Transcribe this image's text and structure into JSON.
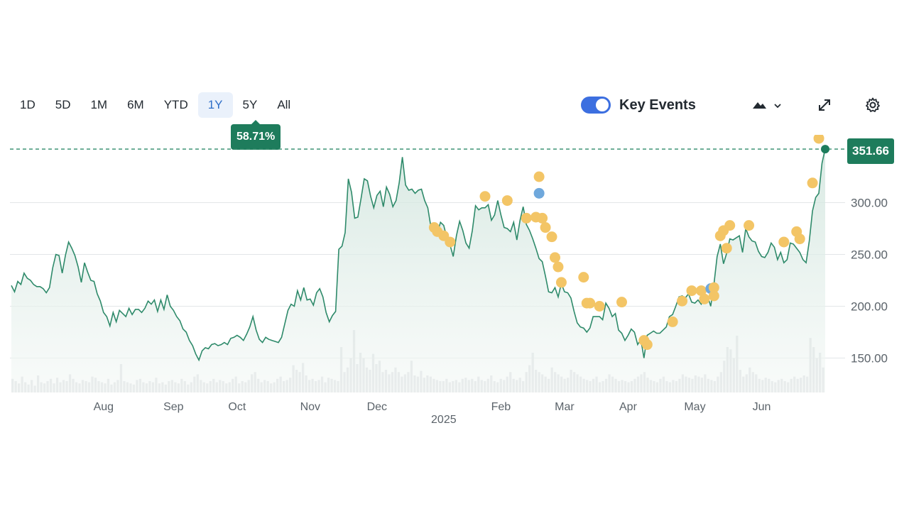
{
  "range_tabs": [
    "1D",
    "5D",
    "1M",
    "6M",
    "YTD",
    "1Y",
    "5Y",
    "All"
  ],
  "active_range": "1Y",
  "performance_badge": "58.71%",
  "key_events": {
    "label": "Key Events",
    "enabled": true
  },
  "toolbar_icons": [
    "mountain-chart-icon",
    "chevron-down-icon",
    "expand-icon",
    "gear-icon"
  ],
  "current_price_label": "351.66",
  "colors": {
    "line": "#2e8a6a",
    "area": "#e2efea",
    "accent": "#1e7c5c",
    "event": "#f3c566",
    "event_alt": "#6fa8dc",
    "toggle": "#3c6fe0"
  },
  "chart_data": {
    "type": "line",
    "y_ticks": [
      "150.00",
      "200.00",
      "250.00",
      "300.00"
    ],
    "y_tick_values": [
      150,
      200,
      250,
      300
    ],
    "ylim": [
      125,
      375
    ],
    "x_tick_labels": [
      "Aug",
      "Sep",
      "Oct",
      "Nov",
      "Dec",
      "2025",
      "Feb",
      "Mar",
      "Apr",
      "May",
      "Jun"
    ],
    "x_tick_positions": [
      29,
      51,
      71,
      94,
      115,
      136,
      154,
      174,
      194,
      215,
      236
    ],
    "last_value": 351.66,
    "reference_line": 351.66,
    "series": [
      {
        "values": [
          220,
          214,
          224,
          221,
          232,
          227,
          225,
          221,
          219,
          219,
          217,
          213,
          218,
          237,
          250,
          249,
          232,
          249,
          262,
          256,
          249,
          238,
          223,
          242,
          233,
          225,
          224,
          212,
          205,
          194,
          190,
          181,
          194,
          185,
          196,
          193,
          190,
          198,
          192,
          197,
          197,
          194,
          198,
          205,
          202,
          206,
          195,
          206,
          197,
          211,
          200,
          196,
          190,
          186,
          178,
          175,
          167,
          162,
          154,
          148,
          157,
          160,
          159,
          163,
          164,
          162,
          163,
          165,
          163,
          169,
          170,
          172,
          170,
          167,
          173,
          180,
          190,
          177,
          168,
          165,
          170,
          168,
          167,
          166,
          165,
          170,
          183,
          196,
          202,
          200,
          215,
          206,
          218,
          206,
          207,
          201,
          213,
          217,
          209,
          194,
          185,
          191,
          195,
          255,
          258,
          271,
          323,
          310,
          285,
          286,
          304,
          323,
          321,
          306,
          295,
          307,
          311,
          296,
          315,
          308,
          296,
          302,
          319,
          344,
          317,
          312,
          313,
          309,
          312,
          313,
          302,
          295,
          276,
          278,
          271,
          281,
          278,
          266,
          259,
          248,
          268,
          282,
          273,
          261,
          256,
          273,
          297,
          293,
          295,
          295,
          298,
          283,
          288,
          302,
          288,
          276,
          275,
          272,
          281,
          264,
          283,
          296,
          279,
          273,
          265,
          256,
          246,
          243,
          229,
          214,
          213,
          218,
          209,
          222,
          214,
          213,
          208,
          195,
          184,
          180,
          179,
          175,
          179,
          190,
          190,
          190,
          187,
          203,
          198,
          190,
          193,
          177,
          174,
          167,
          172,
          178,
          175,
          163,
          168,
          150,
          172,
          174,
          176,
          174,
          174,
          177,
          180,
          190,
          192,
          200,
          209,
          210,
          208,
          212,
          204,
          203,
          206,
          202,
          209,
          210,
          200,
          221,
          248,
          260,
          241,
          251,
          265,
          264,
          266,
          268,
          252,
          275,
          267,
          263,
          262,
          253,
          248,
          247,
          252,
          261,
          257,
          245,
          252,
          242,
          245,
          261,
          260,
          256,
          252,
          245,
          242,
          263,
          292,
          305,
          309,
          338,
          352
        ],
        "area": true
      }
    ],
    "events": [
      {
        "i": 133,
        "v": 276,
        "kind": "earnings"
      },
      {
        "i": 134,
        "v": 272,
        "kind": "earnings"
      },
      {
        "i": 136,
        "v": 268,
        "kind": "earnings"
      },
      {
        "i": 138,
        "v": 262,
        "kind": "earnings"
      },
      {
        "i": 149,
        "v": 306,
        "kind": "earnings"
      },
      {
        "i": 156,
        "v": 302,
        "kind": "earnings"
      },
      {
        "i": 162,
        "v": 285,
        "kind": "earnings"
      },
      {
        "i": 165,
        "v": 286,
        "kind": "earnings"
      },
      {
        "i": 166,
        "v": 325,
        "kind": "earnings"
      },
      {
        "i": 166,
        "v": 309,
        "kind": "dividend"
      },
      {
        "i": 167,
        "v": 285,
        "kind": "earnings"
      },
      {
        "i": 168,
        "v": 276,
        "kind": "earnings"
      },
      {
        "i": 170,
        "v": 267,
        "kind": "earnings"
      },
      {
        "i": 171,
        "v": 247,
        "kind": "earnings"
      },
      {
        "i": 172,
        "v": 238,
        "kind": "earnings"
      },
      {
        "i": 173,
        "v": 223,
        "kind": "earnings"
      },
      {
        "i": 180,
        "v": 228,
        "kind": "earnings"
      },
      {
        "i": 181,
        "v": 203,
        "kind": "earnings"
      },
      {
        "i": 182,
        "v": 203,
        "kind": "earnings"
      },
      {
        "i": 185,
        "v": 200,
        "kind": "earnings"
      },
      {
        "i": 192,
        "v": 204,
        "kind": "earnings"
      },
      {
        "i": 199,
        "v": 167,
        "kind": "earnings"
      },
      {
        "i": 200,
        "v": 163,
        "kind": "earnings"
      },
      {
        "i": 208,
        "v": 185,
        "kind": "earnings"
      },
      {
        "i": 211,
        "v": 205,
        "kind": "earnings"
      },
      {
        "i": 214,
        "v": 215,
        "kind": "earnings"
      },
      {
        "i": 217,
        "v": 215,
        "kind": "earnings"
      },
      {
        "i": 218,
        "v": 207,
        "kind": "earnings"
      },
      {
        "i": 220,
        "v": 217,
        "kind": "dividend"
      },
      {
        "i": 221,
        "v": 218,
        "kind": "earnings"
      },
      {
        "i": 221,
        "v": 210,
        "kind": "earnings"
      },
      {
        "i": 223,
        "v": 268,
        "kind": "earnings"
      },
      {
        "i": 224,
        "v": 273,
        "kind": "earnings"
      },
      {
        "i": 225,
        "v": 256,
        "kind": "earnings"
      },
      {
        "i": 226,
        "v": 278,
        "kind": "earnings"
      },
      {
        "i": 232,
        "v": 278,
        "kind": "earnings"
      },
      {
        "i": 243,
        "v": 262,
        "kind": "earnings"
      },
      {
        "i": 247,
        "v": 272,
        "kind": "earnings"
      },
      {
        "i": 248,
        "v": 265,
        "kind": "earnings"
      },
      {
        "i": 252,
        "v": 319,
        "kind": "earnings"
      },
      {
        "i": 254,
        "v": 362,
        "kind": "earnings"
      }
    ],
    "volume": [
      12,
      10,
      8,
      14,
      9,
      7,
      11,
      6,
      15,
      9,
      8,
      10,
      12,
      8,
      13,
      9,
      11,
      10,
      16,
      12,
      9,
      8,
      11,
      10,
      9,
      14,
      13,
      10,
      9,
      8,
      12,
      7,
      9,
      11,
      25,
      10,
      9,
      8,
      7,
      11,
      12,
      9,
      8,
      10,
      9,
      13,
      8,
      9,
      7,
      10,
      11,
      9,
      8,
      12,
      10,
      7,
      9,
      14,
      16,
      11,
      9,
      8,
      10,
      12,
      9,
      11,
      10,
      8,
      9,
      12,
      14,
      8,
      10,
      9,
      11,
      16,
      18,
      12,
      9,
      11,
      10,
      8,
      9,
      12,
      14,
      10,
      11,
      13,
      24,
      20,
      18,
      26,
      15,
      11,
      12,
      10,
      11,
      14,
      9,
      13,
      12,
      11,
      10,
      40,
      18,
      22,
      30,
      55,
      25,
      35,
      30,
      22,
      20,
      34,
      25,
      28,
      18,
      20,
      16,
      18,
      22,
      18,
      14,
      16,
      18,
      28,
      15,
      14,
      19,
      13,
      15,
      14,
      12,
      11,
      10,
      10,
      12,
      9,
      10,
      11,
      9,
      12,
      13,
      11,
      12,
      10,
      14,
      11,
      10,
      12,
      15,
      10,
      9,
      12,
      11,
      14,
      18,
      12,
      11,
      13,
      10,
      18,
      24,
      35,
      20,
      18,
      16,
      14,
      12,
      22,
      18,
      16,
      14,
      12,
      13,
      20,
      18,
      16,
      14,
      12,
      11,
      10,
      12,
      14,
      9,
      10,
      12,
      16,
      14,
      12,
      10,
      11,
      10,
      9,
      10,
      12,
      14,
      16,
      18,
      13,
      11,
      10,
      9,
      12,
      14,
      10,
      9,
      11,
      10,
      12,
      16,
      14,
      13,
      12,
      15,
      14,
      13,
      16,
      12,
      11,
      10,
      14,
      18,
      28,
      40,
      38,
      30,
      50,
      20,
      14,
      16,
      22,
      18,
      16,
      12,
      11,
      13,
      12,
      10,
      9,
      11,
      12,
      10,
      9,
      12,
      14,
      12,
      13,
      15,
      14,
      48,
      40,
      30,
      35,
      22
    ]
  }
}
